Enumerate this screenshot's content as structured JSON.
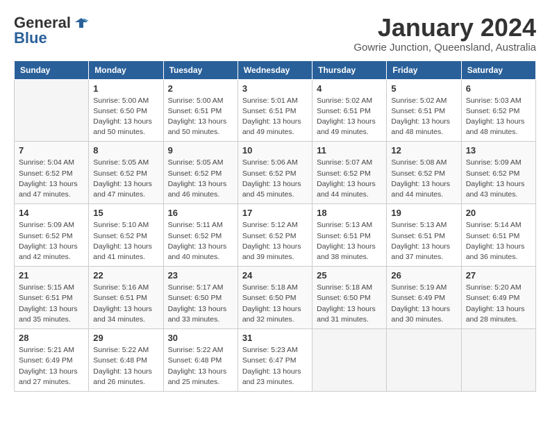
{
  "logo": {
    "general": "General",
    "blue": "Blue"
  },
  "header": {
    "month": "January 2024",
    "location": "Gowrie Junction, Queensland, Australia"
  },
  "days_of_week": [
    "Sunday",
    "Monday",
    "Tuesday",
    "Wednesday",
    "Thursday",
    "Friday",
    "Saturday"
  ],
  "weeks": [
    [
      {
        "day": "",
        "sunrise": "",
        "sunset": "",
        "daylight": ""
      },
      {
        "day": "1",
        "sunrise": "Sunrise: 5:00 AM",
        "sunset": "Sunset: 6:50 PM",
        "daylight": "Daylight: 13 hours and 50 minutes."
      },
      {
        "day": "2",
        "sunrise": "Sunrise: 5:00 AM",
        "sunset": "Sunset: 6:51 PM",
        "daylight": "Daylight: 13 hours and 50 minutes."
      },
      {
        "day": "3",
        "sunrise": "Sunrise: 5:01 AM",
        "sunset": "Sunset: 6:51 PM",
        "daylight": "Daylight: 13 hours and 49 minutes."
      },
      {
        "day": "4",
        "sunrise": "Sunrise: 5:02 AM",
        "sunset": "Sunset: 6:51 PM",
        "daylight": "Daylight: 13 hours and 49 minutes."
      },
      {
        "day": "5",
        "sunrise": "Sunrise: 5:02 AM",
        "sunset": "Sunset: 6:51 PM",
        "daylight": "Daylight: 13 hours and 48 minutes."
      },
      {
        "day": "6",
        "sunrise": "Sunrise: 5:03 AM",
        "sunset": "Sunset: 6:52 PM",
        "daylight": "Daylight: 13 hours and 48 minutes."
      }
    ],
    [
      {
        "day": "7",
        "sunrise": "Sunrise: 5:04 AM",
        "sunset": "Sunset: 6:52 PM",
        "daylight": "Daylight: 13 hours and 47 minutes."
      },
      {
        "day": "8",
        "sunrise": "Sunrise: 5:05 AM",
        "sunset": "Sunset: 6:52 PM",
        "daylight": "Daylight: 13 hours and 47 minutes."
      },
      {
        "day": "9",
        "sunrise": "Sunrise: 5:05 AM",
        "sunset": "Sunset: 6:52 PM",
        "daylight": "Daylight: 13 hours and 46 minutes."
      },
      {
        "day": "10",
        "sunrise": "Sunrise: 5:06 AM",
        "sunset": "Sunset: 6:52 PM",
        "daylight": "Daylight: 13 hours and 45 minutes."
      },
      {
        "day": "11",
        "sunrise": "Sunrise: 5:07 AM",
        "sunset": "Sunset: 6:52 PM",
        "daylight": "Daylight: 13 hours and 44 minutes."
      },
      {
        "day": "12",
        "sunrise": "Sunrise: 5:08 AM",
        "sunset": "Sunset: 6:52 PM",
        "daylight": "Daylight: 13 hours and 44 minutes."
      },
      {
        "day": "13",
        "sunrise": "Sunrise: 5:09 AM",
        "sunset": "Sunset: 6:52 PM",
        "daylight": "Daylight: 13 hours and 43 minutes."
      }
    ],
    [
      {
        "day": "14",
        "sunrise": "Sunrise: 5:09 AM",
        "sunset": "Sunset: 6:52 PM",
        "daylight": "Daylight: 13 hours and 42 minutes."
      },
      {
        "day": "15",
        "sunrise": "Sunrise: 5:10 AM",
        "sunset": "Sunset: 6:52 PM",
        "daylight": "Daylight: 13 hours and 41 minutes."
      },
      {
        "day": "16",
        "sunrise": "Sunrise: 5:11 AM",
        "sunset": "Sunset: 6:52 PM",
        "daylight": "Daylight: 13 hours and 40 minutes."
      },
      {
        "day": "17",
        "sunrise": "Sunrise: 5:12 AM",
        "sunset": "Sunset: 6:52 PM",
        "daylight": "Daylight: 13 hours and 39 minutes."
      },
      {
        "day": "18",
        "sunrise": "Sunrise: 5:13 AM",
        "sunset": "Sunset: 6:51 PM",
        "daylight": "Daylight: 13 hours and 38 minutes."
      },
      {
        "day": "19",
        "sunrise": "Sunrise: 5:13 AM",
        "sunset": "Sunset: 6:51 PM",
        "daylight": "Daylight: 13 hours and 37 minutes."
      },
      {
        "day": "20",
        "sunrise": "Sunrise: 5:14 AM",
        "sunset": "Sunset: 6:51 PM",
        "daylight": "Daylight: 13 hours and 36 minutes."
      }
    ],
    [
      {
        "day": "21",
        "sunrise": "Sunrise: 5:15 AM",
        "sunset": "Sunset: 6:51 PM",
        "daylight": "Daylight: 13 hours and 35 minutes."
      },
      {
        "day": "22",
        "sunrise": "Sunrise: 5:16 AM",
        "sunset": "Sunset: 6:51 PM",
        "daylight": "Daylight: 13 hours and 34 minutes."
      },
      {
        "day": "23",
        "sunrise": "Sunrise: 5:17 AM",
        "sunset": "Sunset: 6:50 PM",
        "daylight": "Daylight: 13 hours and 33 minutes."
      },
      {
        "day": "24",
        "sunrise": "Sunrise: 5:18 AM",
        "sunset": "Sunset: 6:50 PM",
        "daylight": "Daylight: 13 hours and 32 minutes."
      },
      {
        "day": "25",
        "sunrise": "Sunrise: 5:18 AM",
        "sunset": "Sunset: 6:50 PM",
        "daylight": "Daylight: 13 hours and 31 minutes."
      },
      {
        "day": "26",
        "sunrise": "Sunrise: 5:19 AM",
        "sunset": "Sunset: 6:49 PM",
        "daylight": "Daylight: 13 hours and 30 minutes."
      },
      {
        "day": "27",
        "sunrise": "Sunrise: 5:20 AM",
        "sunset": "Sunset: 6:49 PM",
        "daylight": "Daylight: 13 hours and 28 minutes."
      }
    ],
    [
      {
        "day": "28",
        "sunrise": "Sunrise: 5:21 AM",
        "sunset": "Sunset: 6:49 PM",
        "daylight": "Daylight: 13 hours and 27 minutes."
      },
      {
        "day": "29",
        "sunrise": "Sunrise: 5:22 AM",
        "sunset": "Sunset: 6:48 PM",
        "daylight": "Daylight: 13 hours and 26 minutes."
      },
      {
        "day": "30",
        "sunrise": "Sunrise: 5:22 AM",
        "sunset": "Sunset: 6:48 PM",
        "daylight": "Daylight: 13 hours and 25 minutes."
      },
      {
        "day": "31",
        "sunrise": "Sunrise: 5:23 AM",
        "sunset": "Sunset: 6:47 PM",
        "daylight": "Daylight: 13 hours and 23 minutes."
      },
      {
        "day": "",
        "sunrise": "",
        "sunset": "",
        "daylight": ""
      },
      {
        "day": "",
        "sunrise": "",
        "sunset": "",
        "daylight": ""
      },
      {
        "day": "",
        "sunrise": "",
        "sunset": "",
        "daylight": ""
      }
    ]
  ]
}
